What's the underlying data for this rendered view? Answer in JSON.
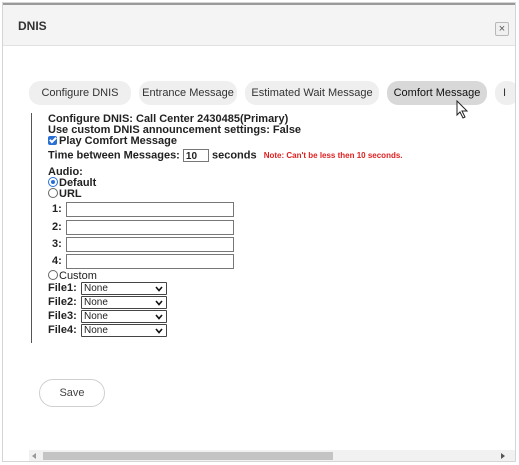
{
  "dialog": {
    "title": "DNIS",
    "close_label": "×"
  },
  "tabs": [
    {
      "label": "Configure DNIS"
    },
    {
      "label": "Entrance Message"
    },
    {
      "label": "Estimated Wait Message"
    },
    {
      "label": "Comfort Message",
      "active": true
    },
    {
      "label": "I"
    }
  ],
  "form": {
    "configure_line": "Configure DNIS: Call Center 2430485(Primary)",
    "custom_settings_line": "Use custom DNIS announcement settings: False",
    "play_comfort": {
      "label": "Play Comfort Message",
      "checked": true
    },
    "time_between": {
      "label": "Time between Messages:",
      "value": "10",
      "unit": "seconds",
      "note": "Note: Can't be less then 10 seconds."
    },
    "audio_label": "Audio:",
    "options": {
      "default": {
        "label": "Default",
        "selected": true
      },
      "url": {
        "label": "URL",
        "selected": false
      },
      "custom": {
        "label": "Custom",
        "selected": false
      }
    },
    "url_fields": [
      {
        "label": "1:",
        "value": ""
      },
      {
        "label": "2:",
        "value": ""
      },
      {
        "label": "3:",
        "value": ""
      },
      {
        "label": "4:",
        "value": ""
      }
    ],
    "files": [
      {
        "label": "File1:",
        "value": "None"
      },
      {
        "label": "File2:",
        "value": "None"
      },
      {
        "label": "File3:",
        "value": "None"
      },
      {
        "label": "File4:",
        "value": "None"
      }
    ]
  },
  "save_label": "Save",
  "colors": {
    "accent": "#2a6fd6",
    "note": "#e02020",
    "active_tab": "#d8d8d8"
  }
}
